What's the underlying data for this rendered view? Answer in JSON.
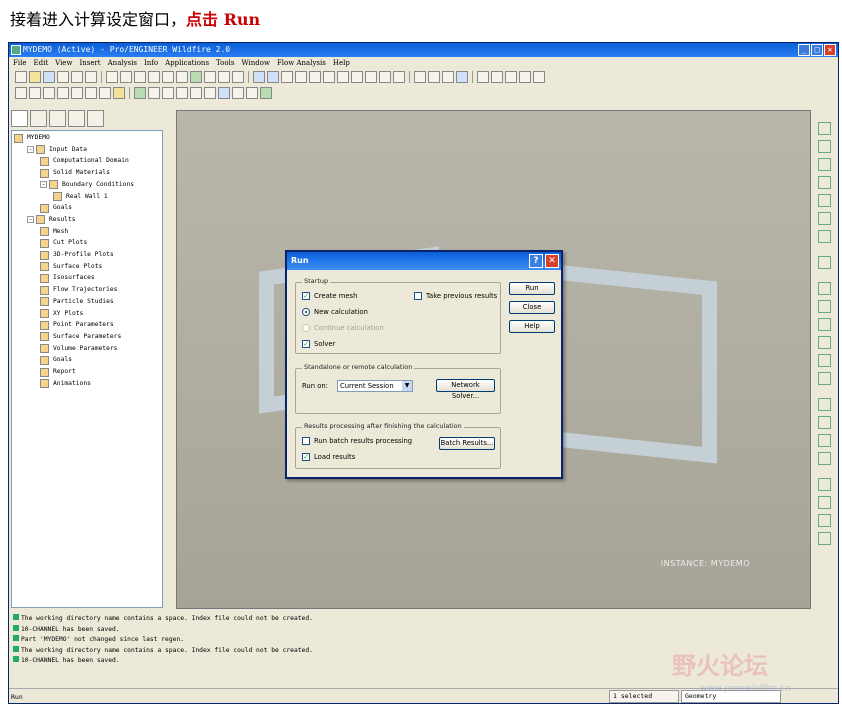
{
  "caption": {
    "text": "接着进入计算设定窗口，",
    "highlight": "点击 Run"
  },
  "window": {
    "title": "MYDEMO (Active) - Pro/ENGINEER Wildfire 2.0"
  },
  "menu": [
    "File",
    "Edit",
    "View",
    "Insert",
    "Analysis",
    "Info",
    "Applications",
    "Tools",
    "Window",
    "Flow Analysis",
    "Help"
  ],
  "tree": {
    "items": [
      {
        "label": "MYDEMO",
        "level": 0,
        "exp": ""
      },
      {
        "label": "Input Data",
        "level": 1,
        "exp": "-"
      },
      {
        "label": "Computational Domain",
        "level": 2,
        "exp": ""
      },
      {
        "label": "Solid Materials",
        "level": 2,
        "exp": ""
      },
      {
        "label": "Boundary Conditions",
        "level": 2,
        "exp": "-"
      },
      {
        "label": "Real Wall 1",
        "level": 3,
        "exp": ""
      },
      {
        "label": "Goals",
        "level": 2,
        "exp": ""
      },
      {
        "label": "Results",
        "level": 1,
        "exp": "-"
      },
      {
        "label": "Mesh",
        "level": 2,
        "exp": ""
      },
      {
        "label": "Cut Plots",
        "level": 2,
        "exp": ""
      },
      {
        "label": "3D-Profile Plots",
        "level": 2,
        "exp": ""
      },
      {
        "label": "Surface Plots",
        "level": 2,
        "exp": ""
      },
      {
        "label": "Isosurfaces",
        "level": 2,
        "exp": ""
      },
      {
        "label": "Flow Trajectories",
        "level": 2,
        "exp": ""
      },
      {
        "label": "Particle Studies",
        "level": 2,
        "exp": ""
      },
      {
        "label": "XY Plots",
        "level": 2,
        "exp": ""
      },
      {
        "label": "Point Parameters",
        "level": 2,
        "exp": ""
      },
      {
        "label": "Surface Parameters",
        "level": 2,
        "exp": ""
      },
      {
        "label": "Volume Parameters",
        "level": 2,
        "exp": ""
      },
      {
        "label": "Goals",
        "level": 2,
        "exp": ""
      },
      {
        "label": "Report",
        "level": 2,
        "exp": ""
      },
      {
        "label": "Animations",
        "level": 2,
        "exp": ""
      }
    ]
  },
  "graphics": {
    "instance": "INSTANCE: MYDEMO"
  },
  "dialog": {
    "title": "Run",
    "startup": {
      "label": "Startup",
      "create_mesh": "Create mesh",
      "take_previous": "Take previous results",
      "new_calc": "New calculation",
      "continue_calc": "Continue calculation",
      "solver": "Solver"
    },
    "remote": {
      "label": "Standalone or remote calculation",
      "run_on": "Run on:",
      "run_on_value": "Current Session",
      "network_btn": "Network Solver..."
    },
    "results": {
      "label": "Results processing after finishing the calculation",
      "batch": "Run batch results processing",
      "batch_btn": "Batch Results...",
      "load": "Load results"
    },
    "run_btn": "Run",
    "close_btn": "Close",
    "help_btn": "Help"
  },
  "messages": [
    "The working directory name contains a space. Index file could not be created.",
    "10-CHANNEL has been saved.",
    "Part 'MYDEMO' not changed since last regen.",
    "The working directory name contains a space. Index file could not be created.",
    "10-CHANNEL has been saved."
  ],
  "status": {
    "text": "Run",
    "selected1": "1 selected",
    "filter1": "Geometry",
    "selected2": "1 selected",
    "filter2": "Geometry"
  },
  "watermark": {
    "text": "野火论坛",
    "url": "www.proewildfire.cn"
  }
}
